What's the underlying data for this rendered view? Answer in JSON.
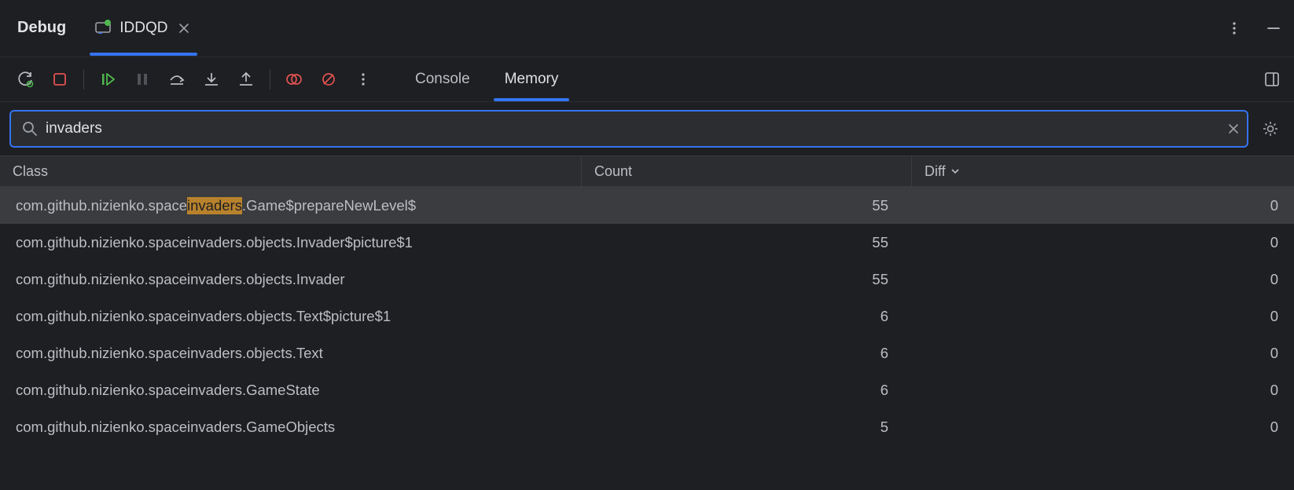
{
  "topbar": {
    "tool_label": "Debug",
    "tab": {
      "label": "IDDQD"
    }
  },
  "subtabs": {
    "console": "Console",
    "memory": "Memory"
  },
  "search": {
    "value": "invaders"
  },
  "table": {
    "headers": {
      "class": "Class",
      "count": "Count",
      "diff": "Diff"
    },
    "rows": [
      {
        "pre": "com.github.nizienko.space",
        "match": "invaders",
        "post": ".Game$prepareNewLevel$",
        "count": "55",
        "diff": "0",
        "selected": true
      },
      {
        "pre": "com.github.nizienko.spaceinvaders.objects.Invader$picture$1",
        "match": "",
        "post": "",
        "count": "55",
        "diff": "0",
        "selected": false
      },
      {
        "pre": "com.github.nizienko.spaceinvaders.objects.Invader",
        "match": "",
        "post": "",
        "count": "55",
        "diff": "0",
        "selected": false
      },
      {
        "pre": "com.github.nizienko.spaceinvaders.objects.Text$picture$1",
        "match": "",
        "post": "",
        "count": "6",
        "diff": "0",
        "selected": false
      },
      {
        "pre": "com.github.nizienko.spaceinvaders.objects.Text",
        "match": "",
        "post": "",
        "count": "6",
        "diff": "0",
        "selected": false
      },
      {
        "pre": "com.github.nizienko.spaceinvaders.GameState",
        "match": "",
        "post": "",
        "count": "6",
        "diff": "0",
        "selected": false
      },
      {
        "pre": "com.github.nizienko.spaceinvaders.GameObjects",
        "match": "",
        "post": "",
        "count": "5",
        "diff": "0",
        "selected": false
      }
    ]
  }
}
